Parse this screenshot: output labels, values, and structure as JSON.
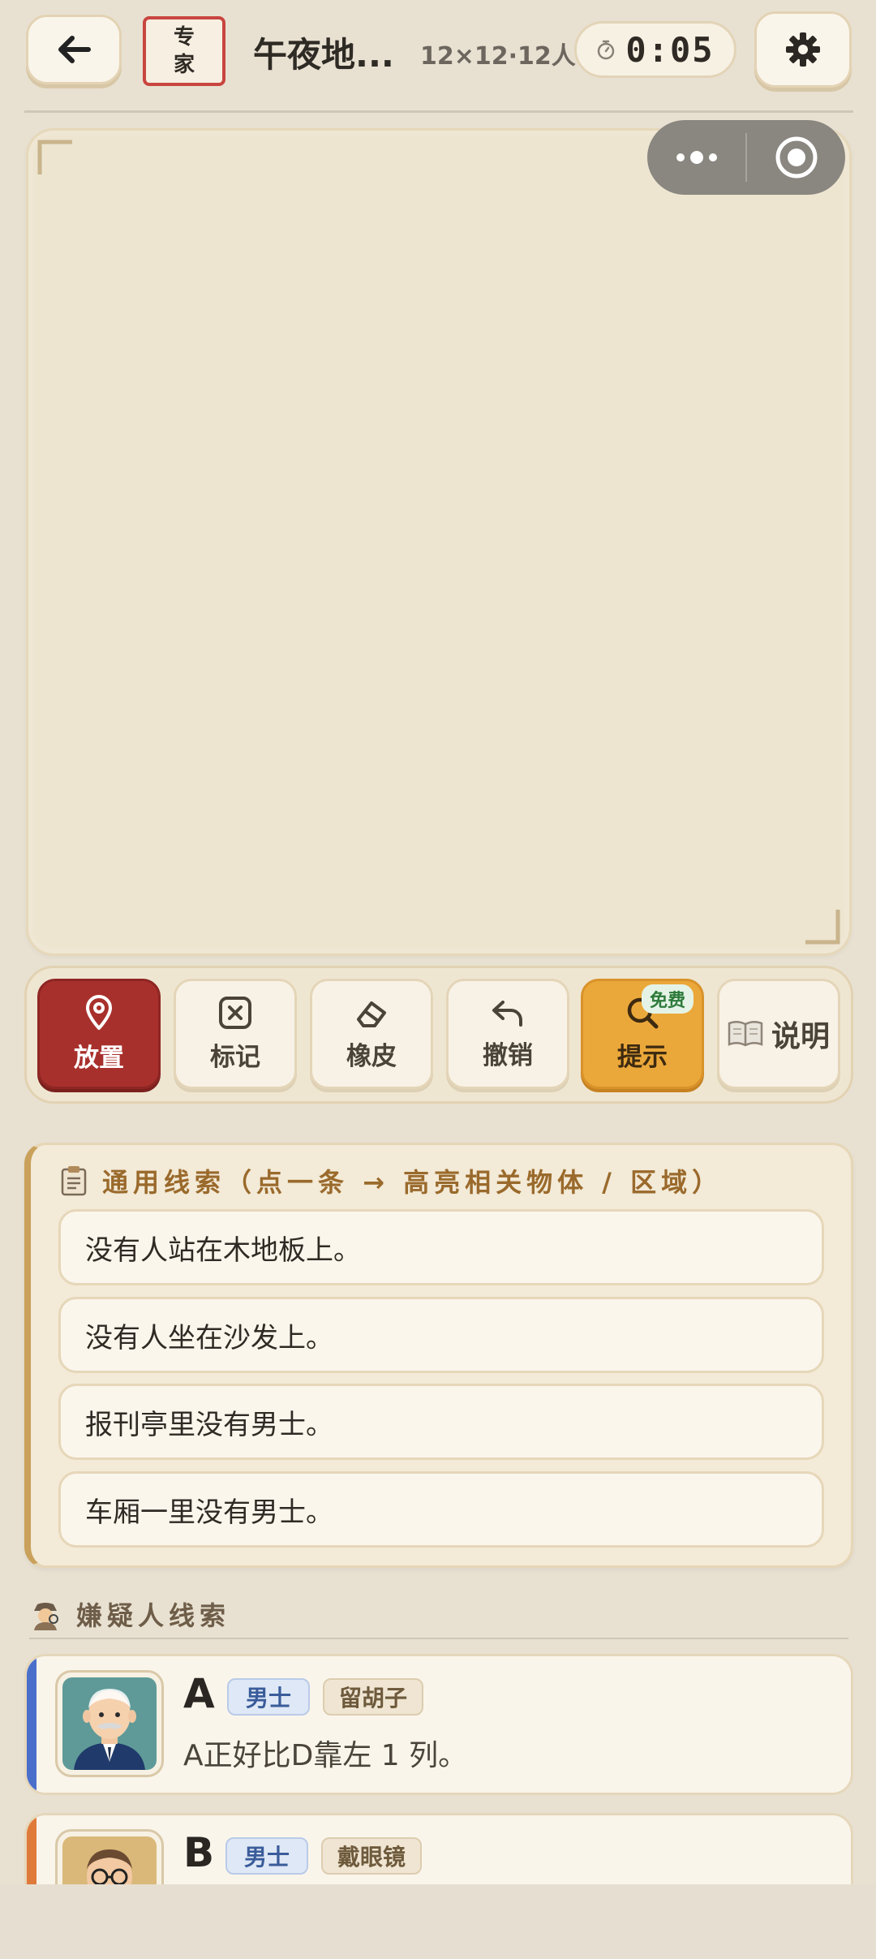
{
  "header": {
    "back_icon": "arrow-left-icon",
    "difficulty_badge": "专家",
    "title": "午夜地...",
    "meta": "12×12·12人",
    "timer": "0:05",
    "timer_icon": "stopwatch-icon",
    "settings_icon": "gear-icon"
  },
  "toolbar": {
    "tools": [
      {
        "label": "放置",
        "icon": "map-pin-icon"
      },
      {
        "label": "标记",
        "icon": "x-box-icon"
      },
      {
        "label": "橡皮",
        "icon": "eraser-icon"
      },
      {
        "label": "撤销",
        "icon": "undo-icon"
      },
      {
        "label": "提示",
        "icon": "search-icon",
        "tag": "免费"
      },
      {
        "label": "说明",
        "icon": "book-icon"
      }
    ]
  },
  "clues": {
    "title": "通用线索（点一条 → 高亮相关物体 / 区域）",
    "icon": "clipboard-icon",
    "items": [
      "没有人站在木地板上。",
      "没有人坐在沙发上。",
      "报刊亭里没有男士。",
      "车厢一里没有男士。"
    ]
  },
  "suspects": {
    "title": "嫌疑人线索",
    "icon": "detective-icon",
    "list": [
      {
        "letter": "A",
        "tags": [
          "男士",
          "留胡子"
        ],
        "clue": "A正好比D靠左 1 列。",
        "stripe": "#4a6fcb"
      },
      {
        "letter": "B",
        "tags": [
          "男士",
          "戴眼镜"
        ],
        "clue": "",
        "stripe": "#e07a3a"
      }
    ]
  },
  "colors": {
    "accent_red": "#a8302c",
    "hint_orange": "#eba83a",
    "clue_gold": "#9a6a2c",
    "background": "#e8e1d2"
  }
}
